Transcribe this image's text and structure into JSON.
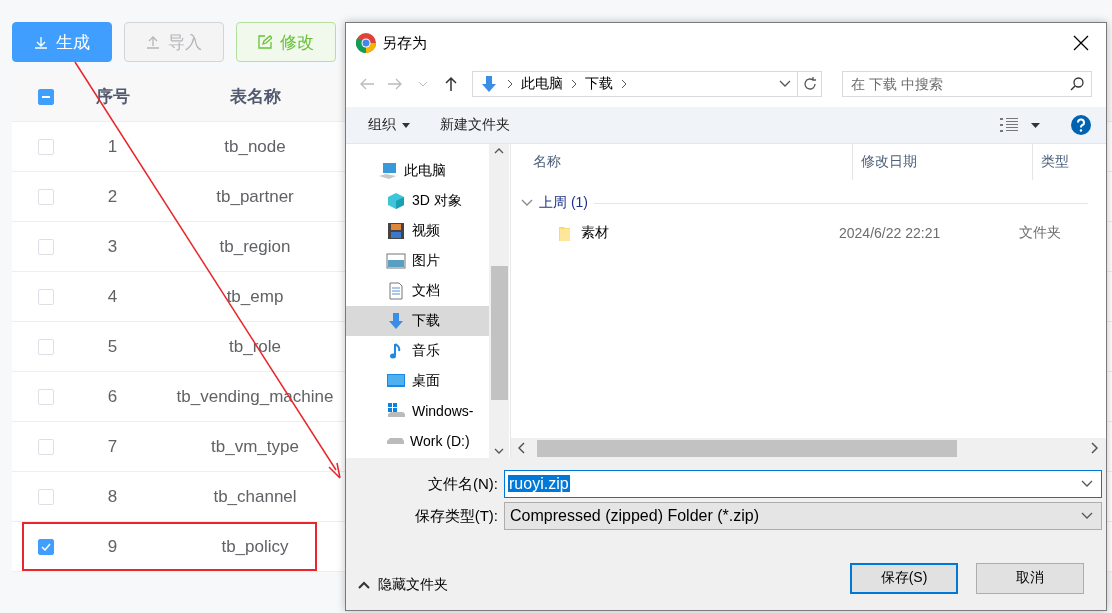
{
  "toolbar": [
    {
      "label": "生成",
      "kind": "primary",
      "disabled": false
    },
    {
      "label": "导入",
      "kind": "default",
      "disabled": true
    },
    {
      "label": "修改",
      "kind": "success",
      "disabled": false
    }
  ],
  "table": {
    "header_indeterminate": true,
    "columns": [
      "序号",
      "表名称"
    ],
    "rows": [
      {
        "index": "1",
        "name": "tb_node",
        "checked": false,
        "highlighted": false
      },
      {
        "index": "2",
        "name": "tb_partner",
        "checked": false,
        "highlighted": false
      },
      {
        "index": "3",
        "name": "tb_region",
        "checked": false,
        "highlighted": false
      },
      {
        "index": "4",
        "name": "tb_emp",
        "checked": false,
        "highlighted": false
      },
      {
        "index": "5",
        "name": "tb_role",
        "checked": false,
        "highlighted": false
      },
      {
        "index": "6",
        "name": "tb_vending_machine",
        "checked": false,
        "highlighted": false
      },
      {
        "index": "7",
        "name": "tb_vm_type",
        "checked": false,
        "highlighted": false
      },
      {
        "index": "8",
        "name": "tb_channel",
        "checked": false,
        "highlighted": false
      },
      {
        "index": "9",
        "name": "tb_policy",
        "checked": true,
        "highlighted": true
      }
    ]
  },
  "dialog": {
    "title": "另存为",
    "path": [
      "此电脑",
      "下载"
    ],
    "search": {
      "placeholder": "在 下载 中搜索"
    },
    "commands": [
      "组织",
      "新建文件夹"
    ],
    "nav": [
      {
        "label": "此电脑",
        "kind": "pc",
        "selected": false
      },
      {
        "label": "3D 对象",
        "kind": "cube",
        "selected": false
      },
      {
        "label": "视频",
        "kind": "video",
        "selected": false
      },
      {
        "label": "图片",
        "kind": "image",
        "selected": false
      },
      {
        "label": "文档",
        "kind": "doc",
        "selected": false
      },
      {
        "label": "下载",
        "kind": "download",
        "selected": true
      },
      {
        "label": "音乐",
        "kind": "music",
        "selected": false
      },
      {
        "label": "桌面",
        "kind": "desktop",
        "selected": false
      },
      {
        "label": "Windows-",
        "kind": "drive-win",
        "selected": false
      },
      {
        "label": "Work (D:)",
        "kind": "drive",
        "selected": false
      }
    ],
    "columns": [
      "名称",
      "修改日期",
      "类型"
    ],
    "groups": [
      {
        "label": "上周 (1)",
        "expanded": true,
        "files": [
          {
            "name": "素材",
            "date": "2024/6/22 22:21",
            "type": "文件夹"
          }
        ]
      }
    ],
    "filename": {
      "label": "文件名(N):",
      "value": "ruoyi.zip"
    },
    "filetype": {
      "label": "保存类型(T):",
      "value": "Compressed (zipped) Folder (*.zip)"
    },
    "hide_folders": "隐藏文件夹",
    "buttons": [
      {
        "label": "保存(S)",
        "default": true
      },
      {
        "label": "取消",
        "default": false
      }
    ]
  }
}
